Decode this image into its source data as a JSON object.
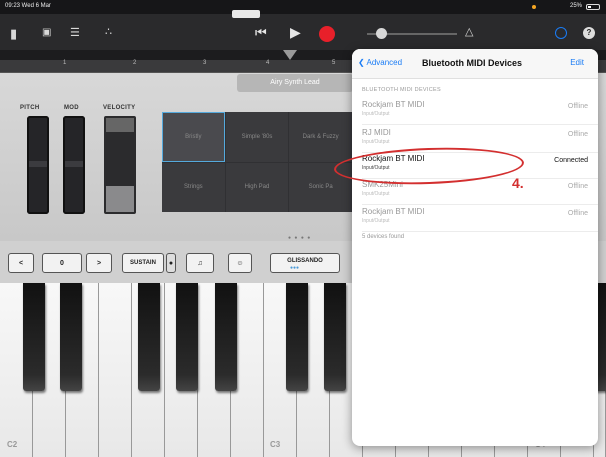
{
  "status_bar": {
    "time": "09:23 Wed 6 Mar",
    "battery": "25%"
  },
  "track": {
    "preset": "Airy Synth Lead"
  },
  "ruler": {
    "marks": [
      "1",
      "2",
      "3",
      "4",
      "5"
    ]
  },
  "controls": {
    "pitch_label": "PITCH",
    "mod_label": "MOD",
    "velocity_label": "VELOCITY",
    "pads": [
      "Bristly",
      "Simple '80s",
      "Dark & Fuzzy",
      "Strings",
      "High Pad",
      "Sonic Pa"
    ]
  },
  "keyboard_bar": {
    "octave_value": "0",
    "prev": "<",
    "next": ">",
    "sustain": "SUSTAIN",
    "glissando": "GLISSANDO"
  },
  "piano": {
    "labels": [
      "C2",
      "C3",
      "C4"
    ]
  },
  "popover": {
    "back_label": "Advanced",
    "title": "Bluetooth MIDI Devices",
    "edit_label": "Edit",
    "section_label": "BLUETOOTH MIDI DEVICES",
    "devices": [
      {
        "name": "Rockjam BT MIDI",
        "sub": "Input/Output",
        "status": "Offline"
      },
      {
        "name": "RJ MIDI",
        "sub": "Input/Output",
        "status": "Offline"
      },
      {
        "name": "Rockjam BT MIDI",
        "sub": "Input/Output",
        "status": "Connected"
      },
      {
        "name": "SMK25Mini",
        "sub": "Input/Output",
        "status": "Offline"
      },
      {
        "name": "Rockjam BT MIDI",
        "sub": "Input/Output",
        "status": "Offline"
      }
    ],
    "footer": "5 devices found"
  },
  "annotation": {
    "step": "4."
  },
  "colors": {
    "accent": "#1a7cf5",
    "record": "#e8202a",
    "annotation": "#d32f2f"
  }
}
